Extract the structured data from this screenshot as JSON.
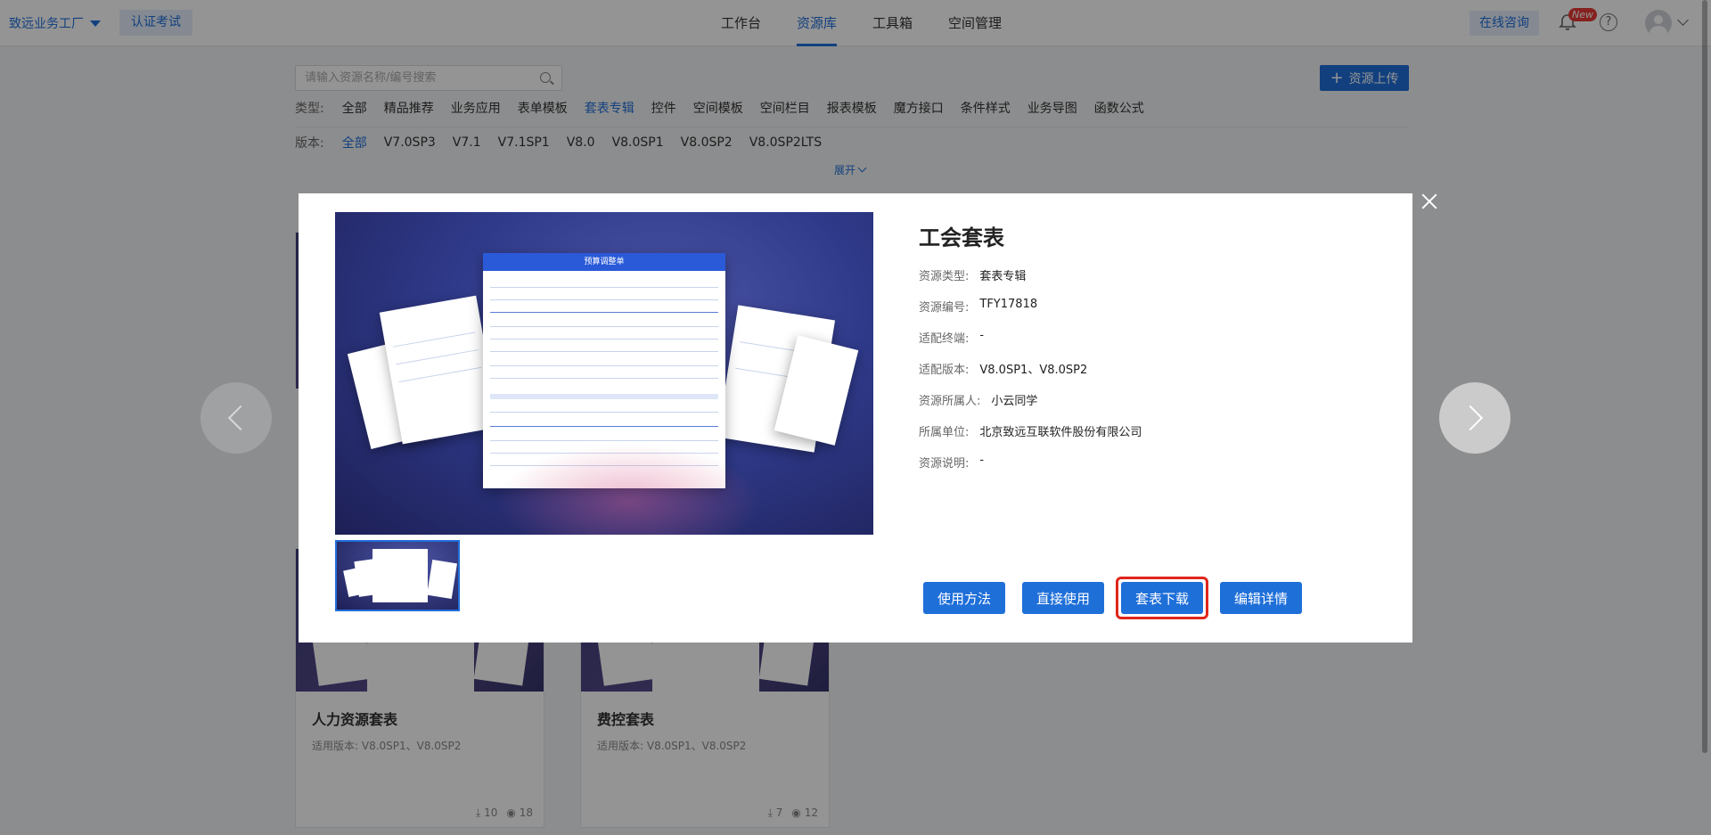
{
  "topbar": {
    "org_name": "致远业务工厂",
    "cert_label": "认证考试",
    "nav": [
      "工作台",
      "资源库",
      "工具箱",
      "空间管理"
    ],
    "consult_label": "在线咨询",
    "new_badge": "New"
  },
  "filters": {
    "search_placeholder": "请输入资源名称/编号搜索",
    "upload_label": "资源上传",
    "type_label": "类型:",
    "types": [
      "全部",
      "精品推荐",
      "业务应用",
      "表单模板",
      "套表专辑",
      "控件",
      "空间模板",
      "空间栏目",
      "报表模板",
      "魔方接口",
      "条件样式",
      "业务导图",
      "函数公式"
    ],
    "version_label": "版本:",
    "versions": [
      "全部",
      "V7.0SP3",
      "V7.1",
      "V7.1SP1",
      "V8.0",
      "V8.0SP1",
      "V8.0SP2",
      "V8.0SP2LTS"
    ],
    "expand_label": "展开"
  },
  "cards": [
    {
      "title": "人力资源套表",
      "version": "适用版本:  V8.0SP1、V8.0SP2",
      "downloads": "10",
      "views": "18"
    },
    {
      "title": "费控套表",
      "version": "适用版本:  V8.0SP1、V8.0SP2",
      "downloads": "7",
      "views": "12"
    }
  ],
  "modal": {
    "title": "工会套表",
    "preview_doc_title": "预算调整单",
    "info": [
      {
        "label": "资源类型:",
        "value": "套表专辑"
      },
      {
        "label": "资源编号:",
        "value": "TFY17818"
      },
      {
        "label": "适配终端:",
        "value": "-"
      },
      {
        "label": "适配版本:",
        "value": "V8.0SP1、V8.0SP2"
      },
      {
        "label": "资源所属人:",
        "value": "小云同学"
      },
      {
        "label": "所属单位:",
        "value": "北京致远互联软件股份有限公司"
      },
      {
        "label": "资源说明:",
        "value": "-"
      }
    ],
    "buttons": {
      "usage": "使用方法",
      "direct_use": "直接使用",
      "download": "套表下载",
      "edit_detail": "编辑详情"
    }
  },
  "colors": {
    "accent": "#1f6fd9",
    "highlight": "#e0261b"
  }
}
